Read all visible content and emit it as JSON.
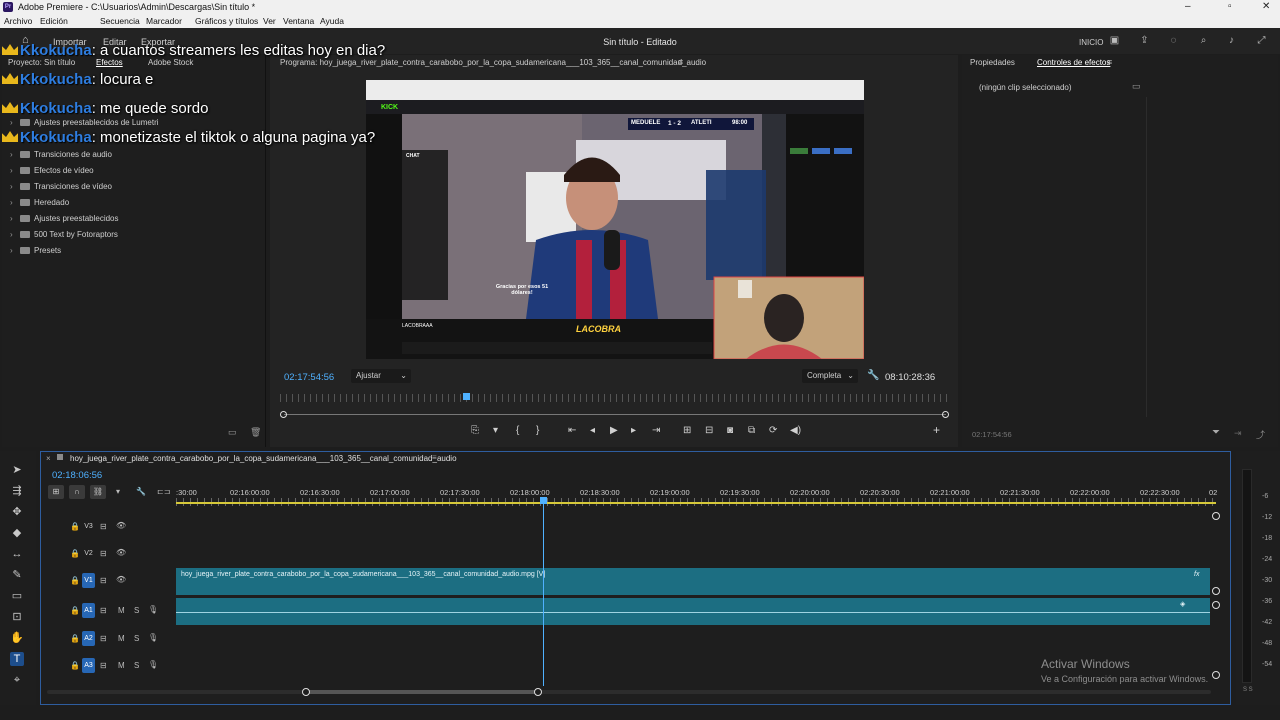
{
  "window": {
    "title": "Adobe Premiere - C:\\Usuarios\\Admin\\Descargas\\Sin título *",
    "app_badge": "Pr"
  },
  "menu": [
    "Archivo",
    "Edición",
    "Secuencia",
    "Marcador",
    "Gráficos y títulos",
    "Ver",
    "Ventana",
    "Ayuda"
  ],
  "header": {
    "nav": [
      "Importar",
      "Editar",
      "Exportar"
    ],
    "center_title": "Sin título - Editado",
    "right_label": "INICIO"
  },
  "left_panel": {
    "project_tab": "Proyecto: Sin título",
    "effects_tab": "Efectos",
    "stock_tab": "Adobe Stock",
    "items": [
      "Ajustes preestablecidos de Lumetri",
      "Transiciones de audio",
      "Efectos de vídeo",
      "Transiciones de vídeo",
      "Heredado",
      "Ajustes preestablecidos",
      "500 Text by Fotoraptors",
      "Presets"
    ]
  },
  "program": {
    "header": "Programa: hoy_juega_river_plate_contra_carabobo_por_la_copa_sudamericana___103_365__canal_comunidad_audio",
    "timecode_current": "02:17:54:56",
    "fit": "Ajustar",
    "quality": "Completa",
    "timecode_duration": "08:10:28:36"
  },
  "video_overlay": {
    "score": "1 - 2",
    "team_left": "MEDUELE",
    "team_right": "ATLETI",
    "clock": "98:00",
    "chat_title": "CHAT",
    "donation": "Gracias por esos 51 dólares!",
    "brand": "LACOBRA",
    "streamer": "LACOBRAAA",
    "kick_logo": "KICK"
  },
  "right_panel": {
    "tab_props": "Propiedades",
    "tab_effects": "Controles de efectos",
    "no_clip": "(ningún clip seleccionado)",
    "timecode": "02:17:54:56"
  },
  "timeline": {
    "sequence_name": "hoy_juega_river_plate_contra_carabobo_por_la_copa_sudamericana___103_365__canal_comunidad_audio",
    "timecode": "02:18:06:56",
    "ruler": [
      ":30:00",
      "02:16:00:00",
      "02:16:30:00",
      "02:17:00:00",
      "02:17:30:00",
      "02:18:00:00",
      "02:18:30:00",
      "02:19:00:00",
      "02:19:30:00",
      "02:20:00:00",
      "02:20:30:00",
      "02:21:00:00",
      "02:21:30:00",
      "02:22:00:00",
      "02:22:30:00",
      "02"
    ],
    "tracks": [
      {
        "id": "V3",
        "kind": "video",
        "active": false
      },
      {
        "id": "V2",
        "kind": "video",
        "active": false
      },
      {
        "id": "V1",
        "kind": "video",
        "active": true
      },
      {
        "id": "A1",
        "kind": "audio",
        "active": true
      },
      {
        "id": "A2",
        "kind": "audio",
        "active": true
      },
      {
        "id": "A3",
        "kind": "audio",
        "active": true
      }
    ],
    "clip_label": "hoy_juega_river_plate_contra_carabobo_por_la_copa_sudamericana___103_365__canal_comunidad_audio.mpg [V]",
    "clip_fx": "fx",
    "track_m": "M",
    "track_s": "S"
  },
  "meters": {
    "scale": [
      "-6",
      "-12",
      "-18",
      "-24",
      "-30",
      "-36",
      "-42",
      "-48",
      "-54"
    ],
    "footer": "S S"
  },
  "chat_overlay": [
    {
      "user": "Kkokucha",
      "text": ": a cuantos streamers les editas hoy en dia?"
    },
    {
      "user": "Kkokucha",
      "text": ": locura e"
    },
    {
      "user": "Kkokucha",
      "text": ": me quede sordo"
    },
    {
      "user": "Kkokucha",
      "text": ": monetizaste el tiktok o alguna pagina ya?"
    }
  ],
  "activation": {
    "title": "Activar Windows",
    "subtitle": "Ve a Configuración para activar Windows."
  },
  "colors": {
    "accent": "#2767b5",
    "clip": "#1c6e82",
    "playhead": "#4fb1ff",
    "chat_user": "#2e7de0"
  }
}
